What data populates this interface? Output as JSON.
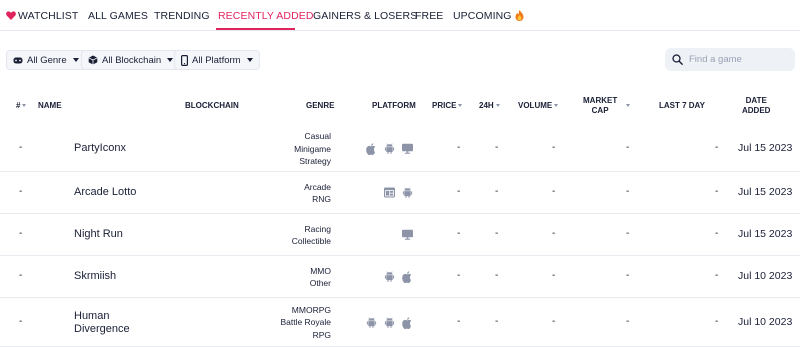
{
  "tabs": [
    {
      "label": "WATCHLIST",
      "icon": "heart-icon",
      "active": false
    },
    {
      "label": "ALL GAMES",
      "active": false
    },
    {
      "label": "TRENDING",
      "active": false
    },
    {
      "label": "RECENTLY ADDED",
      "active": true
    },
    {
      "label": "GAINERS & LOSERS",
      "active": false
    },
    {
      "label": "FREE",
      "active": false
    },
    {
      "label": "UPCOMING",
      "icon": "fire-icon",
      "active": false
    }
  ],
  "filters": {
    "genre": "All Genre",
    "blockchain": "All Blockchain",
    "platform": "All Platform"
  },
  "search": {
    "placeholder": "Find a game"
  },
  "columns": {
    "rank": "#",
    "name": "NAME",
    "blockchain": "BLOCKCHAIN",
    "genre": "GENRE",
    "platform": "PLATFORM",
    "price": "PRICE",
    "change_24h": "24H",
    "volume": "VOLUME",
    "market_cap_1": "MARKET",
    "market_cap_2": "CAP",
    "last7": "LAST 7 DAY",
    "date_added_1": "DATE",
    "date_added_2": "ADDED"
  },
  "rows": [
    {
      "rank": "-",
      "name_1": "PartyIconx",
      "name_2": "",
      "genres": [
        "Casual",
        "Minigame",
        "Strategy"
      ],
      "platforms": [
        "apple",
        "android",
        "desktop"
      ],
      "price": "-",
      "change_24h": "-",
      "volume": "-",
      "market_cap": "-",
      "last7": "-",
      "date": "Jul 15 2023"
    },
    {
      "rank": "-",
      "name_1": "Arcade Lotto",
      "name_2": "",
      "genres": [
        "Arcade",
        "RNG"
      ],
      "platforms": [
        "browser",
        "android"
      ],
      "price": "-",
      "change_24h": "-",
      "volume": "-",
      "market_cap": "-",
      "last7": "-",
      "date": "Jul 15 2023"
    },
    {
      "rank": "-",
      "name_1": "Night Run",
      "name_2": "",
      "genres": [
        "Racing",
        "Collectible"
      ],
      "platforms": [
        "desktop"
      ],
      "price": "-",
      "change_24h": "-",
      "volume": "-",
      "market_cap": "-",
      "last7": "-",
      "date": "Jul 15 2023"
    },
    {
      "rank": "-",
      "name_1": "Skrmiish",
      "name_2": "",
      "genres": [
        "MMO",
        "Other"
      ],
      "platforms": [
        "android",
        "apple"
      ],
      "price": "-",
      "change_24h": "-",
      "volume": "-",
      "market_cap": "-",
      "last7": "-",
      "date": "Jul 10 2023"
    },
    {
      "rank": "-",
      "name_1": "Human",
      "name_2": "Divergence",
      "genres": [
        "MMORPG",
        "Battle Royale",
        "RPG"
      ],
      "platforms": [
        "android",
        "android",
        "apple"
      ],
      "price": "-",
      "change_24h": "-",
      "volume": "-",
      "market_cap": "-",
      "last7": "-",
      "date": "Jul 10 2023"
    }
  ],
  "colors": {
    "accent": "#e0245e",
    "icon_gray": "#8d94a8",
    "divider": "#e9ebf1"
  }
}
